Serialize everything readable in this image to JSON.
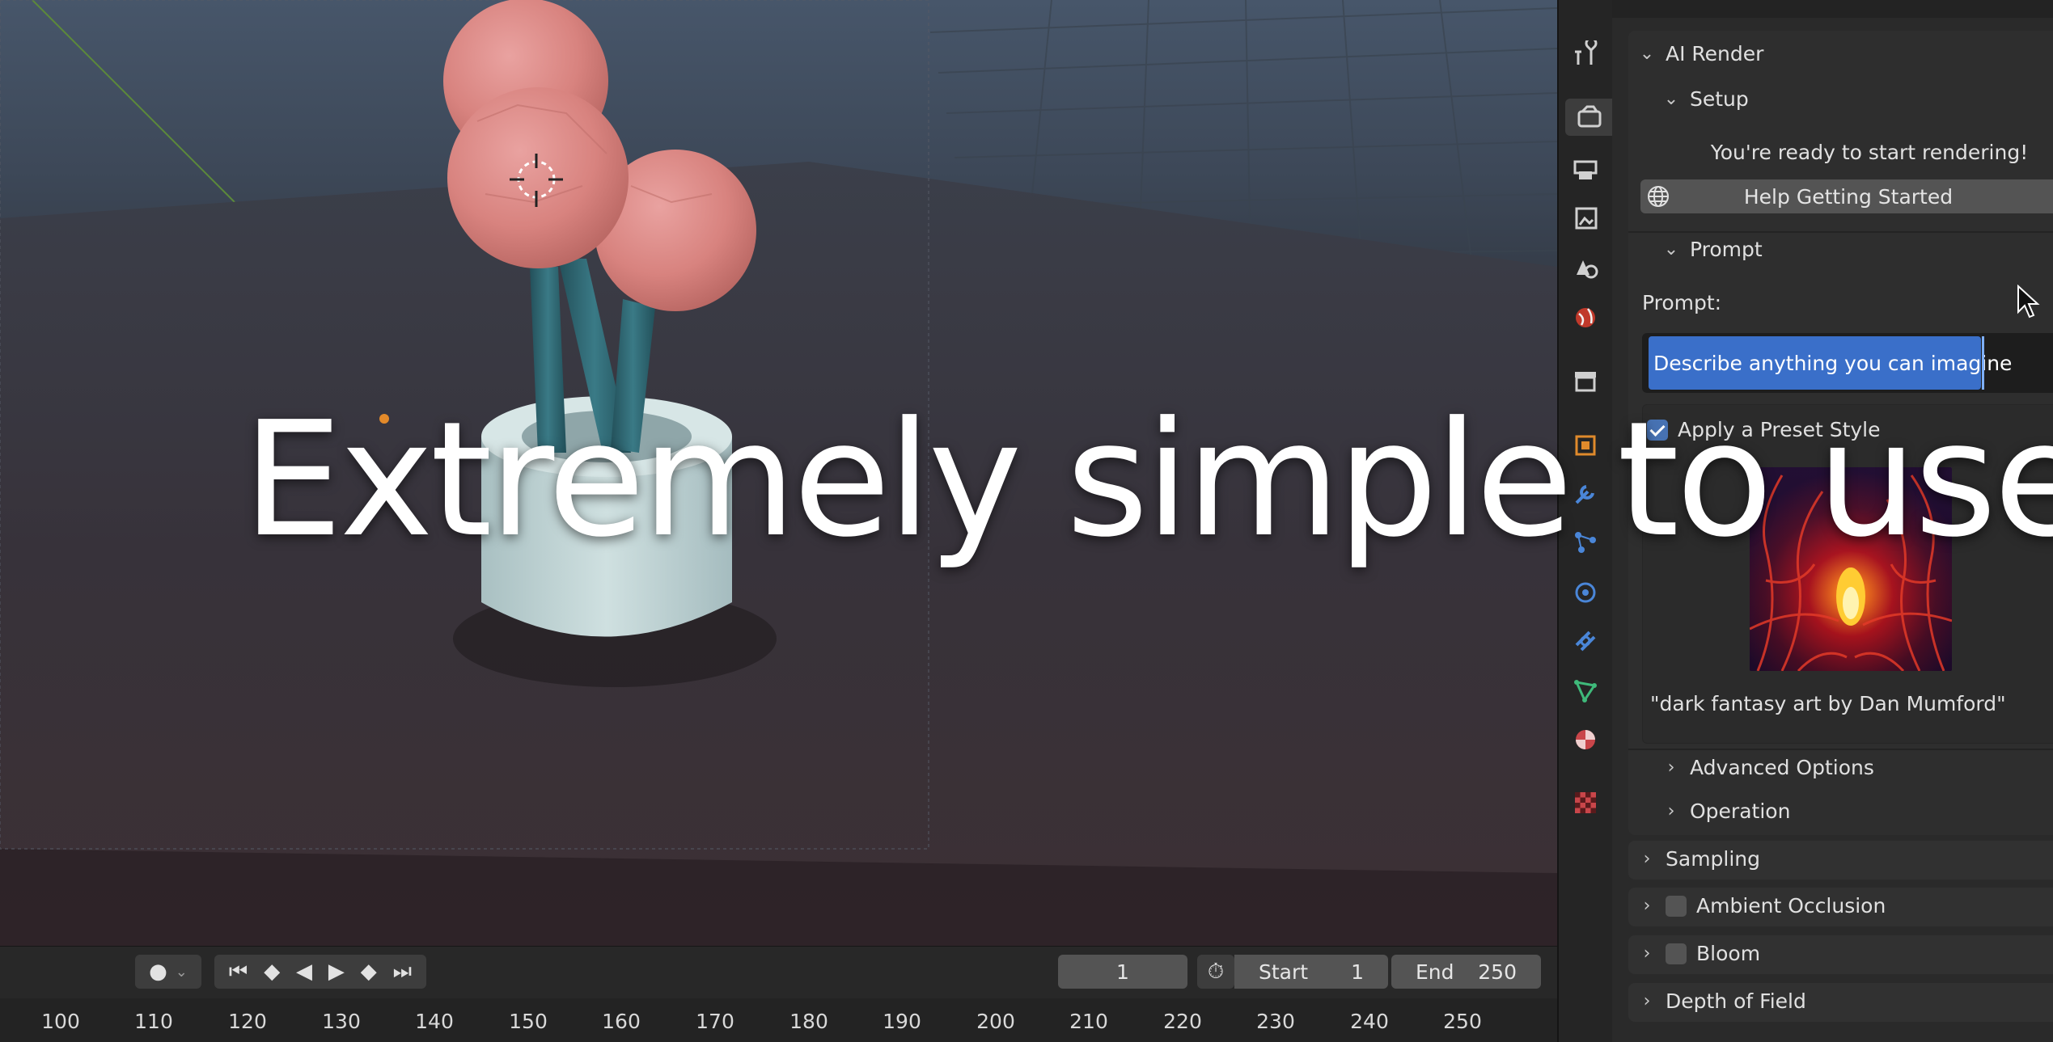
{
  "overlay": {
    "caption": "Extremely simple to use"
  },
  "timeline": {
    "current_frame": "1",
    "start_label": "Start",
    "start_value": "1",
    "end_label": "End",
    "end_value": "250",
    "ruler_ticks": [
      "100",
      "110",
      "120",
      "130",
      "140",
      "150",
      "160",
      "170",
      "180",
      "190",
      "200",
      "210",
      "220",
      "230",
      "240",
      "250"
    ]
  },
  "properties": {
    "ai_render": {
      "title": "AI Render",
      "setup": {
        "title": "Setup",
        "status": "You're ready to start rendering!",
        "help_button": "Help Getting Started"
      },
      "prompt": {
        "title": "Prompt",
        "label": "Prompt:",
        "value": "Describe anything you can imagine",
        "preset_checkbox_label": "Apply a Preset Style",
        "preset_checked": true,
        "preset_caption": "\"dark fantasy art by Dan Mumford\""
      },
      "advanced_options": "Advanced Options",
      "operation": "Operation"
    },
    "sampling": "Sampling",
    "ambient_occlusion": "Ambient Occlusion",
    "bloom": "Bloom",
    "depth_of_field": "Depth of Field"
  },
  "colors": {
    "accent_blue": "#4772b3",
    "panel_bg": "#313131",
    "selection_blue": "#3a6fc9"
  },
  "icons": [
    "tool-icon",
    "render-icon",
    "output-icon",
    "view-layer-icon",
    "scene-icon",
    "world-icon",
    "collection-icon",
    "object-icon",
    "modifier-icon",
    "particles-icon",
    "physics-icon",
    "constraints-icon",
    "data-icon",
    "material-icon",
    "texture-icon"
  ]
}
